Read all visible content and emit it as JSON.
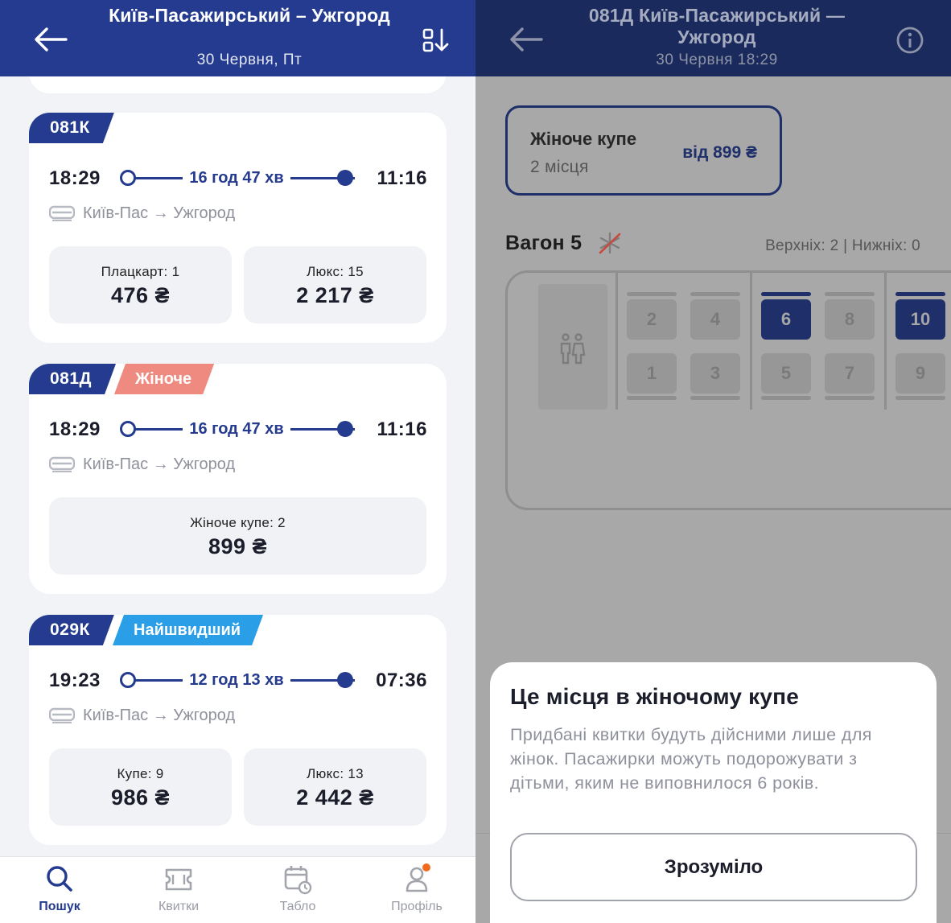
{
  "search": {
    "header": {
      "title": "Київ-Пасажирський – Ужгород",
      "date": "30 Червня, Пт"
    },
    "trains": [
      {
        "number": "081К",
        "badge": "",
        "badge_color": "",
        "departure": "18:29",
        "duration": "16 год 47 хв",
        "arrival": "11:16",
        "route": "Київ-Пас → Ужгород",
        "fares": [
          {
            "class": "Плацкарт: 1",
            "price": "476 ₴"
          },
          {
            "class": "Люкс: 15",
            "price": "2 217 ₴"
          }
        ]
      },
      {
        "number": "081Д",
        "badge": "Жіноче купе",
        "badge_color": "#ef8a80",
        "departure": "18:29",
        "duration": "16 год 47 хв",
        "arrival": "11:16",
        "route": "Київ-Пас → Ужгород",
        "fares": [
          {
            "class": "Жіноче купе: 2",
            "price": "899 ₴"
          }
        ]
      },
      {
        "number": "029К",
        "badge": "Найшвидший",
        "badge_color": "#2a9ee6",
        "departure": "19:23",
        "duration": "12 год 13 хв",
        "arrival": "07:36",
        "route": "Київ-Пас → Ужгород",
        "fares": [
          {
            "class": "Купе: 9",
            "price": "986 ₴"
          },
          {
            "class": "Люкс: 13",
            "price": "2 442 ₴"
          }
        ]
      }
    ],
    "tabbar": [
      {
        "label": "Пошук",
        "icon": "search-icon",
        "active": true
      },
      {
        "label": "Квитки",
        "icon": "ticket-icon",
        "active": false
      },
      {
        "label": "Табло",
        "icon": "calendar-clock-icon",
        "active": false
      },
      {
        "label": "Профіль",
        "icon": "profile-icon",
        "active": false,
        "notification_dot": true
      }
    ]
  },
  "seat_selection": {
    "header": {
      "title": "081Д Київ-Пасажирський — Ужгород",
      "subtitle": "30 Червня 18:29"
    },
    "class_option": {
      "name": "Жіноче купе",
      "seats": "2 місця",
      "price": "від 899 ₴"
    },
    "wagon": {
      "title": "Вагон 5",
      "berths": "Верхніх: 2 | Нижніх: 0",
      "seats_top": [
        {
          "number": "2",
          "selected": false
        },
        {
          "number": "4",
          "selected": false
        },
        {
          "number": "6",
          "selected": true
        },
        {
          "number": "8",
          "selected": false
        },
        {
          "number": "10",
          "selected": true
        }
      ],
      "seats_bottom": [
        {
          "number": "1",
          "selected": false
        },
        {
          "number": "3",
          "selected": false
        },
        {
          "number": "5",
          "selected": false
        },
        {
          "number": "7",
          "selected": false
        },
        {
          "number": "9",
          "selected": false
        }
      ]
    },
    "sheet": {
      "title": "Це місця в жіночому купе",
      "body": "Придбані квитки будуть дійсними лише для жінок. Пасажирки можуть подорожувати з дітьми, яким не виповнилося 6 років.",
      "button": "Зрозуміло"
    }
  },
  "colors": {
    "brand_blue": "#243b8f",
    "accent_orange": "#f26b1d"
  }
}
